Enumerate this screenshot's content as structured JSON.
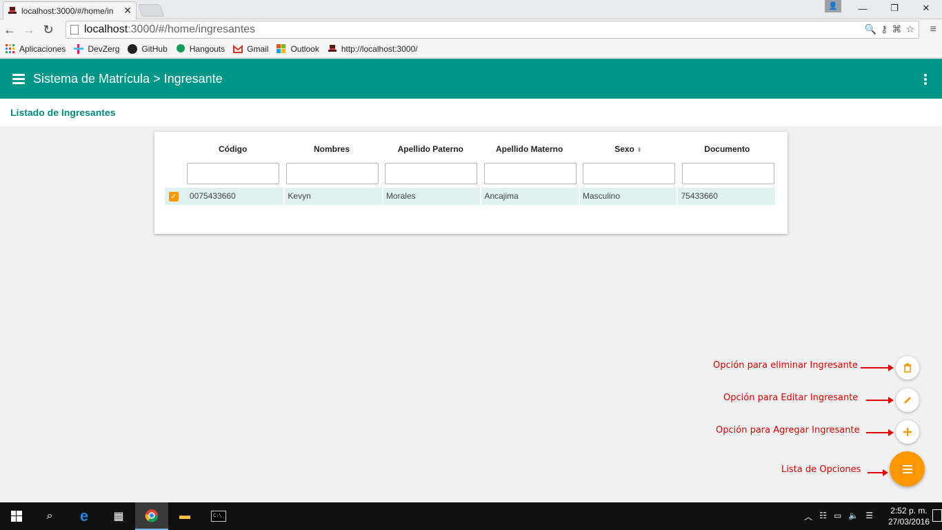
{
  "browser": {
    "tab_title": "localhost:3000/#/home/in",
    "tab_close": "✕",
    "url_host": "localhost",
    "url_path": ":3000/#/home/ingresantes",
    "window_buttons": [
      "—",
      "❐",
      "✕"
    ],
    "bookmarks": [
      {
        "label": "Aplicaciones",
        "icon": "apps-grid-icon",
        "color": "#e53935"
      },
      {
        "label": "DevZerg",
        "icon": "slack-icon",
        "color": "#6ecadc"
      },
      {
        "label": "GitHub",
        "icon": "github-icon",
        "color": "#222222"
      },
      {
        "label": "Hangouts",
        "icon": "hangouts-icon",
        "color": "#0f9d58"
      },
      {
        "label": "Gmail",
        "icon": "gmail-icon",
        "color": "#d93025"
      },
      {
        "label": "Outlook",
        "icon": "windows-icon",
        "color": "#f25022"
      },
      {
        "label": "http://localhost:3000/",
        "icon": "hat-icon",
        "color": "#5a1a1a"
      }
    ]
  },
  "app": {
    "title": "Sistema de Matrícula > Ingresante",
    "subtitle": "Listado de Ingresantes",
    "accent": "#009688",
    "fab_color": "#ff9800"
  },
  "table": {
    "columns": [
      "Código",
      "Nombres",
      "Apellido Paterno",
      "Apellido Materno",
      "Sexo",
      "Documento"
    ],
    "sort_indicator": "⬍",
    "rows": [
      {
        "selected": true,
        "cells": [
          "0075433660",
          "Kevyn",
          "Morales",
          "Ancajima",
          "Masculino",
          "75433660"
        ]
      }
    ]
  },
  "annotations": {
    "delete": "Opción para eliminar Ingresante",
    "edit": "Opción para Editar Ingresante",
    "add": "Opción para Agregar Ingresante",
    "list": "Lista de Opciones"
  },
  "taskbar": {
    "time": "2:52 p. m.",
    "date": "27/03/2016"
  }
}
